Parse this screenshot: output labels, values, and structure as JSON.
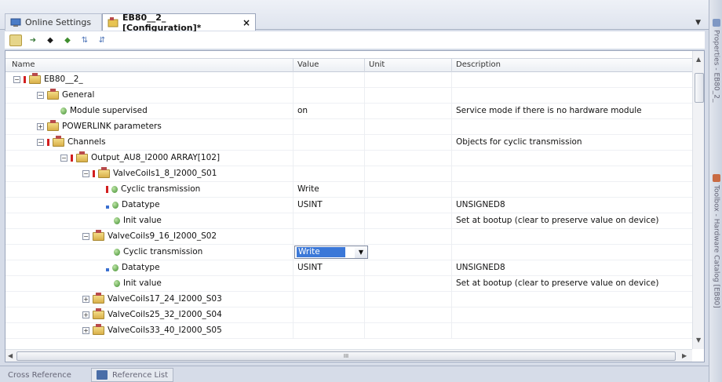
{
  "tabs": [
    {
      "label": "Online Settings",
      "active": false,
      "icon": "online-settings-icon"
    },
    {
      "label": "EB80__2_ [Configuration]*",
      "active": true,
      "icon": "configuration-icon"
    }
  ],
  "close_glyph": "×",
  "side_tabs": {
    "top": "Properties - EB80_2_",
    "bottom": "Toolbox - Hardware Catalog [EB80]"
  },
  "toolbar_icons": [
    "grid-view-icon",
    "arrow-right-icon",
    "connect-icon",
    "disconnect-icon",
    "sort-asc-icon",
    "sort-desc-icon"
  ],
  "columns": {
    "name": "Name",
    "value": "Value",
    "unit": "Unit",
    "description": "Description"
  },
  "rows": [
    {
      "name": "EB80__2_",
      "value": "",
      "unit": "",
      "description": ""
    },
    {
      "name": "General",
      "value": "",
      "unit": "",
      "description": ""
    },
    {
      "name": "Module supervised",
      "value": "on",
      "unit": "",
      "description": "Service mode if there is no hardware module"
    },
    {
      "name": "POWERLINK parameters",
      "value": "",
      "unit": "",
      "description": ""
    },
    {
      "name": "Channels",
      "value": "",
      "unit": "",
      "description": "Objects for cyclic transmission"
    },
    {
      "name": "Output_AU8_I2000 ARRAY[102]",
      "value": "",
      "unit": "",
      "description": ""
    },
    {
      "name": "ValveCoils1_8_I2000_S01",
      "value": "",
      "unit": "",
      "description": ""
    },
    {
      "name": "Cyclic transmission",
      "value": "Write",
      "unit": "",
      "description": ""
    },
    {
      "name": "Datatype",
      "value": "USINT",
      "unit": "",
      "description": "UNSIGNED8"
    },
    {
      "name": "Init value",
      "value": "",
      "unit": "",
      "description": "Set at bootup (clear to preserve value on device)"
    },
    {
      "name": "ValveCoils9_16_I2000_S02",
      "value": "",
      "unit": "",
      "description": ""
    },
    {
      "name": "Cyclic transmission",
      "value": "Write",
      "unit": "",
      "description": ""
    },
    {
      "name": "Datatype",
      "value": "USINT",
      "unit": "",
      "description": "UNSIGNED8"
    },
    {
      "name": "Init value",
      "value": "",
      "unit": "",
      "description": "Set at bootup (clear to preserve value on device)"
    },
    {
      "name": "ValveCoils17_24_I2000_S03",
      "value": "",
      "unit": "",
      "description": ""
    },
    {
      "name": "ValveCoils25_32_I2000_S04",
      "value": "",
      "unit": "",
      "description": ""
    },
    {
      "name": "ValveCoils33_40_I2000_S05",
      "value": "",
      "unit": "",
      "description": ""
    }
  ],
  "hscroll_grip": "III",
  "bottom_tabs": [
    {
      "label": "Cross Reference",
      "icon": ""
    },
    {
      "label": "Reference List",
      "icon": "reference-list-icon"
    }
  ],
  "colors": {
    "selection": "#3b78d8",
    "error_mark": "#d21f1f",
    "param_icon": "#3f8d2e"
  }
}
